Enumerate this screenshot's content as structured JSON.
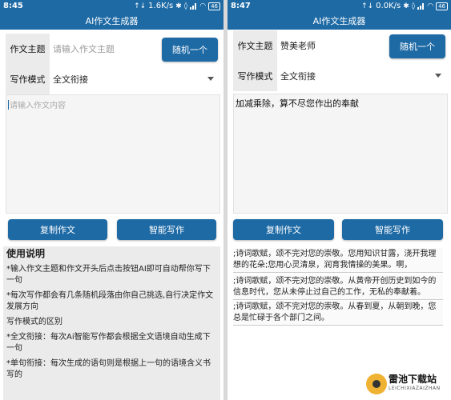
{
  "left": {
    "status": {
      "time": "8:45",
      "speed": "1.6K/s",
      "battery": "46"
    },
    "title": "AI作文生成器",
    "topic": {
      "label": "作文主题",
      "placeholder": "请输入作文主题",
      "value": ""
    },
    "random_button": "随机一个",
    "mode": {
      "label": "写作模式",
      "selected": "全文衔接"
    },
    "content_placeholder": "请输入作文内容",
    "copy_button": "复制作文",
    "smart_button": "智能写作",
    "instructions": {
      "heading": "使用说明",
      "items": [
        "*输入作文主题和作文开头后点击按钮AI即可自动帮你写下一句",
        "*每次写作都会有几条随机段落由你自己挑选,自行决定作文发展方向",
        "写作模式的区别",
        "*全文衔接：每次Ai智能写作都会根据全文语境自动生成下一句",
        "*单句衔接：每次生成的语句则是根据上一句的语境含义书写的"
      ]
    }
  },
  "right": {
    "status": {
      "time": "8:47",
      "speed": "0.0K/s",
      "battery": "46"
    },
    "title": "AI作文生成器",
    "topic": {
      "label": "作文主题",
      "value": "赞美老师"
    },
    "random_button": "随机一个",
    "mode": {
      "label": "写作模式",
      "selected": "全文衔接"
    },
    "content": "加减乘除，算不尽您作出的奉献",
    "copy_button": "复制作文",
    "smart_button": "智能写作",
    "results": [
      ";诗词歌赋，颂不完对您的崇敬。您用知识甘露，浇开我理想的花朵;您用心灵清泉，润育我情操的美果。啊，",
      ";诗词歌赋，颂不完对您的崇敬。从黄帝开创历史到如今的信息时代，您从未停止过自己的工作，无私的奉献着。",
      ";诗词歌赋，颂不完对您的崇敬。从春到夏，从朝到晚，您总是忙碌于各个部门之间。"
    ]
  },
  "watermark": {
    "main": "雷池下载站",
    "sub": "LEICHIXIAZAIZHAN"
  },
  "colors": {
    "primary": "#1e6aa5",
    "label_bg": "#ebebeb"
  }
}
